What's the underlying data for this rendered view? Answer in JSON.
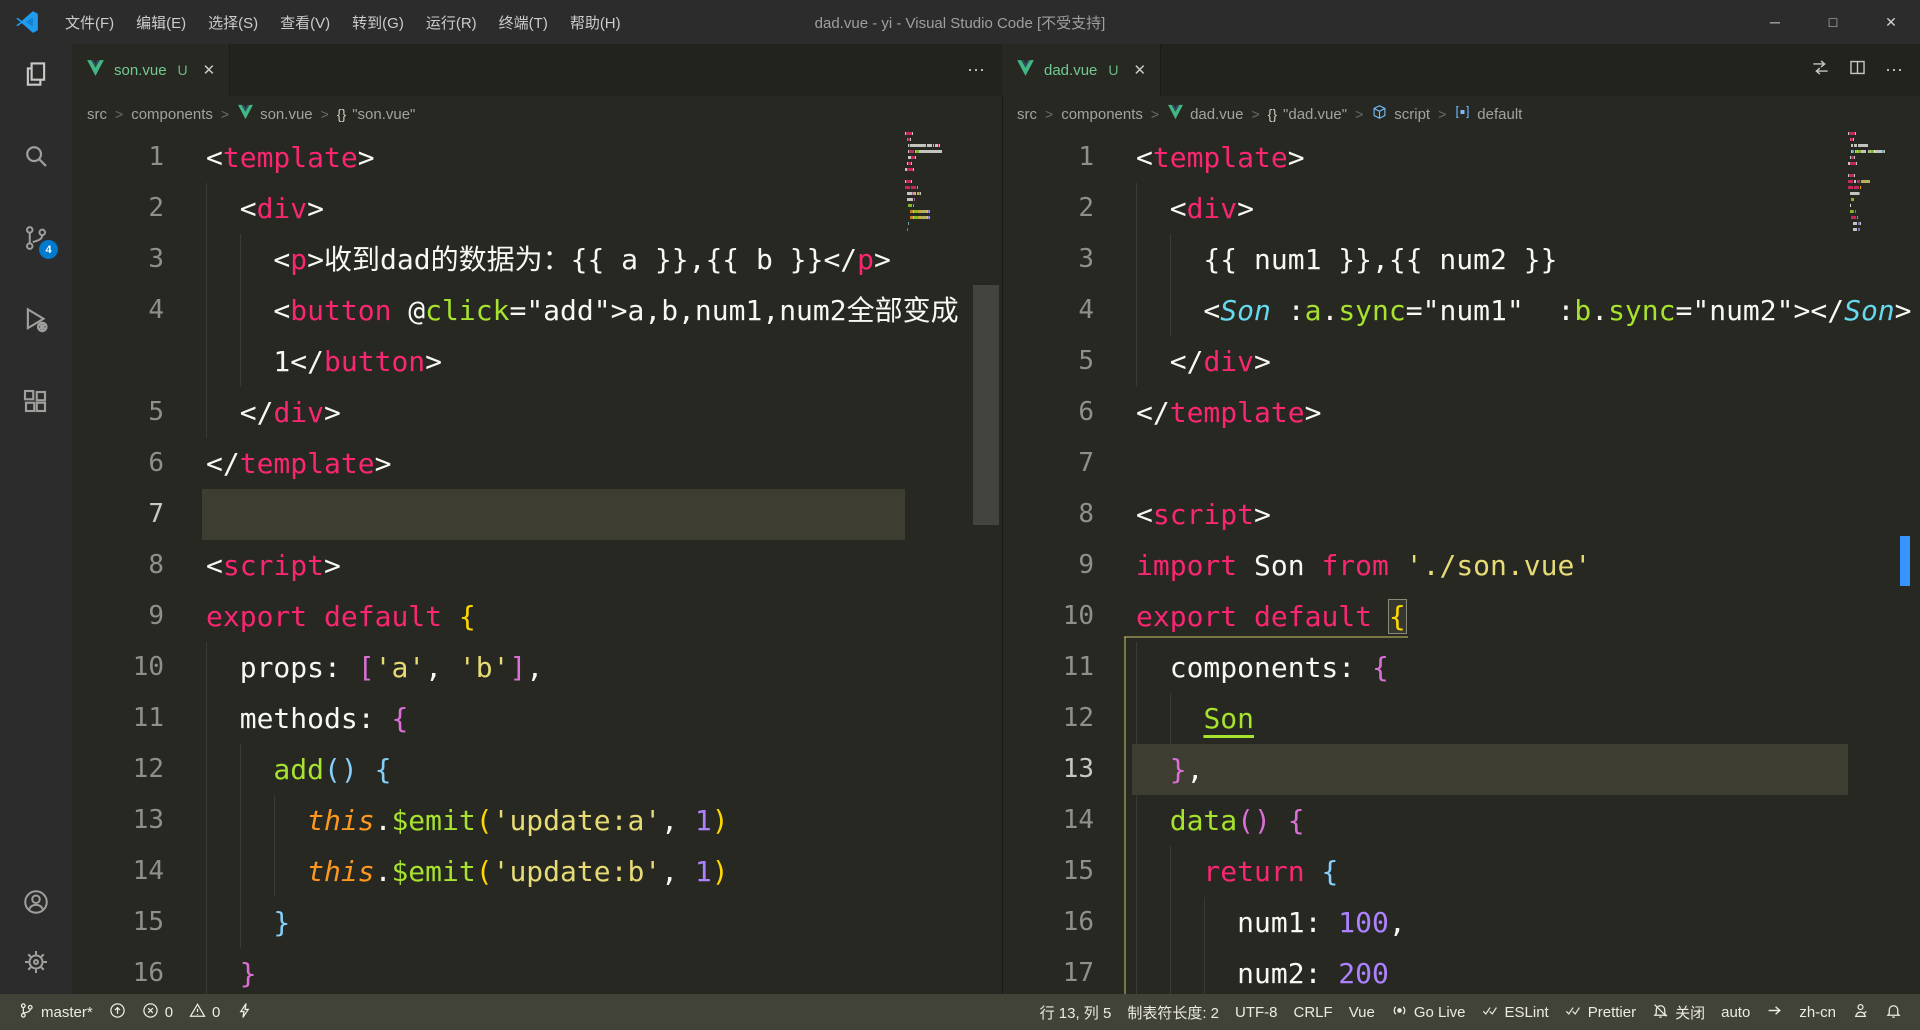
{
  "window": {
    "title": "dad.vue - yi - Visual Studio Code [不受支持]",
    "menus": [
      "文件(F)",
      "编辑(E)",
      "选择(S)",
      "查看(V)",
      "转到(G)",
      "运行(R)",
      "终端(T)",
      "帮助(H)"
    ],
    "glyphs": {
      "minimize": "─",
      "maximize": "□",
      "close": "✕",
      "ellipsis": "⋯",
      "braces": "{}",
      "crumb_sep": ">"
    }
  },
  "activity_bar": {
    "items": [
      {
        "name": "explorer",
        "icon": "files",
        "badge": ""
      },
      {
        "name": "search",
        "icon": "search",
        "badge": ""
      },
      {
        "name": "source-control",
        "icon": "scm",
        "badge": "4"
      },
      {
        "name": "run-and-debug",
        "icon": "debug",
        "badge": ""
      },
      {
        "name": "extensions",
        "icon": "extensions",
        "badge": ""
      }
    ],
    "bottom": [
      {
        "name": "accounts",
        "icon": "account"
      },
      {
        "name": "settings",
        "icon": "gear"
      }
    ]
  },
  "colors": {
    "accent": "#007acc",
    "editor_bg": "#272822",
    "line_highlight": "#3e3d32",
    "tab_modified_green": "#73c991",
    "overview_mark_blue": "#3794ff",
    "tokens": {
      "fg": "#f8f8f2",
      "tag": "#f92672",
      "kw": "#f92672",
      "attr": "#a6e22e",
      "attru": "#a6e22e",
      "str": "#e6db74",
      "num": "#ae81ff",
      "this": "#fd971f",
      "cls": "#66d9ef",
      "b1": "#ffd700",
      "b1m": "#ffd700",
      "b2": "#da70d6",
      "b3": "#87cefa"
    }
  },
  "groups": [
    {
      "name": "left",
      "tab": {
        "file": "son.vue",
        "git": "U"
      },
      "actions": [
        "ellipsis"
      ],
      "breadcrumb": [
        {
          "label": "src"
        },
        {
          "label": "components"
        },
        {
          "label": "son.vue",
          "icon": "vue"
        },
        {
          "label": "\"son.vue\"",
          "icon": "braces"
        }
      ],
      "lines": [
        {
          "n": "1",
          "i": 0,
          "t": [
            [
              "<",
              "fg"
            ],
            [
              "template",
              "tag"
            ],
            [
              ">",
              "fg"
            ]
          ]
        },
        {
          "n": "2",
          "i": 2,
          "t": [
            [
              "  <",
              "fg"
            ],
            [
              "div",
              "tag"
            ],
            [
              ">",
              "fg"
            ]
          ]
        },
        {
          "n": "3",
          "i": 4,
          "t": [
            [
              "    <",
              "fg"
            ],
            [
              "p",
              "tag"
            ],
            [
              ">",
              "fg"
            ],
            [
              "收到dad的数据为：{{ a }},{{ b }}",
              "fg"
            ],
            [
              "</",
              "fg"
            ],
            [
              "p",
              "tag"
            ],
            [
              ">",
              "fg"
            ]
          ]
        },
        {
          "n": "4",
          "i": 4,
          "t": [
            [
              "    <",
              "fg"
            ],
            [
              "button",
              "tag"
            ],
            [
              " @",
              "fg"
            ],
            [
              "click",
              "attr"
            ],
            [
              "=",
              "fg"
            ],
            [
              "\"add\"",
              "fg"
            ],
            [
              ">",
              "fg"
            ],
            [
              "a,b,num1,num2全部变成",
              "fg"
            ]
          ]
        },
        {
          "n": "",
          "i": 4,
          "w": 1,
          "t": [
            [
              "    1",
              "fg"
            ],
            [
              "</",
              "fg"
            ],
            [
              "button",
              "tag"
            ],
            [
              ">",
              "fg"
            ]
          ]
        },
        {
          "n": "5",
          "i": 2,
          "t": [
            [
              "  </",
              "fg"
            ],
            [
              "div",
              "tag"
            ],
            [
              ">",
              "fg"
            ]
          ]
        },
        {
          "n": "6",
          "i": 0,
          "t": [
            [
              "</",
              "fg"
            ],
            [
              "template",
              "tag"
            ],
            [
              ">",
              "fg"
            ]
          ]
        },
        {
          "n": "7",
          "i": 0,
          "c": 1,
          "t": []
        },
        {
          "n": "8",
          "i": 0,
          "t": [
            [
              "<",
              "fg"
            ],
            [
              "script",
              "tag"
            ],
            [
              ">",
              "fg"
            ]
          ]
        },
        {
          "n": "9",
          "i": 0,
          "t": [
            [
              "export",
              "kw"
            ],
            [
              " ",
              "fg"
            ],
            [
              "default",
              "kw"
            ],
            [
              " ",
              "fg"
            ],
            [
              "{",
              "b1"
            ]
          ]
        },
        {
          "n": "10",
          "i": 2,
          "t": [
            [
              "  props",
              "fg"
            ],
            [
              ": ",
              "fg"
            ],
            [
              "[",
              "b2"
            ],
            [
              "'a'",
              "str"
            ],
            [
              ", ",
              "fg"
            ],
            [
              "'b'",
              "str"
            ],
            [
              "]",
              "b2"
            ],
            [
              ",",
              "fg"
            ]
          ]
        },
        {
          "n": "11",
          "i": 2,
          "t": [
            [
              "  methods",
              "fg"
            ],
            [
              ": ",
              "fg"
            ],
            [
              "{",
              "b2"
            ]
          ]
        },
        {
          "n": "12",
          "i": 4,
          "t": [
            [
              "    add",
              "attr"
            ],
            [
              "()",
              "b3"
            ],
            [
              " ",
              "fg"
            ],
            [
              "{",
              "b3"
            ]
          ]
        },
        {
          "n": "13",
          "i": 6,
          "t": [
            [
              "      this",
              "this"
            ],
            [
              ".",
              "fg"
            ],
            [
              "$emit",
              "attr"
            ],
            [
              "(",
              "b1"
            ],
            [
              "'update:a'",
              "str"
            ],
            [
              ", ",
              "fg"
            ],
            [
              "1",
              "num"
            ],
            [
              ")",
              "b1"
            ]
          ]
        },
        {
          "n": "14",
          "i": 6,
          "t": [
            [
              "      this",
              "this"
            ],
            [
              ".",
              "fg"
            ],
            [
              "$emit",
              "attr"
            ],
            [
              "(",
              "b1"
            ],
            [
              "'update:b'",
              "str"
            ],
            [
              ", ",
              "fg"
            ],
            [
              "1",
              "num"
            ],
            [
              ")",
              "b1"
            ]
          ]
        },
        {
          "n": "15",
          "i": 4,
          "t": [
            [
              "    }",
              "b3"
            ]
          ]
        },
        {
          "n": "16",
          "i": 2,
          "t": [
            [
              "  }",
              "b2"
            ]
          ]
        }
      ]
    },
    {
      "name": "right",
      "tab": {
        "file": "dad.vue",
        "git": "U"
      },
      "actions": [
        "compare",
        "split",
        "ellipsis"
      ],
      "breadcrumb": [
        {
          "label": "src"
        },
        {
          "label": "components"
        },
        {
          "label": "dad.vue",
          "icon": "vue"
        },
        {
          "label": "\"dad.vue\"",
          "icon": "braces"
        },
        {
          "label": "script",
          "icon": "cube"
        },
        {
          "label": "default",
          "icon": "symbol"
        }
      ],
      "lines": [
        {
          "n": "1",
          "i": 0,
          "t": [
            [
              "<",
              "fg"
            ],
            [
              "template",
              "tag"
            ],
            [
              ">",
              "fg"
            ]
          ]
        },
        {
          "n": "2",
          "i": 2,
          "t": [
            [
              "  <",
              "fg"
            ],
            [
              "div",
              "tag"
            ],
            [
              ">",
              "fg"
            ]
          ]
        },
        {
          "n": "3",
          "i": 4,
          "t": [
            [
              "    {{ num1 }},{{ num2 }}",
              "fg"
            ]
          ]
        },
        {
          "n": "4",
          "i": 4,
          "t": [
            [
              "    <",
              "fg"
            ],
            [
              "Son",
              "cls"
            ],
            [
              " :",
              "fg"
            ],
            [
              "a",
              "attr"
            ],
            [
              ".",
              "fg"
            ],
            [
              "sync",
              "attr"
            ],
            [
              "=",
              "fg"
            ],
            [
              "\"num1\"",
              "fg"
            ],
            [
              "  :",
              "fg"
            ],
            [
              "b",
              "attr"
            ],
            [
              ".",
              "fg"
            ],
            [
              "sync",
              "attr"
            ],
            [
              "=",
              "fg"
            ],
            [
              "\"num2\"",
              "fg"
            ],
            [
              "></",
              "fg"
            ],
            [
              "Son",
              "cls"
            ],
            [
              ">",
              "fg"
            ]
          ]
        },
        {
          "n": "5",
          "i": 2,
          "t": [
            [
              "  </",
              "fg"
            ],
            [
              "div",
              "tag"
            ],
            [
              ">",
              "fg"
            ]
          ]
        },
        {
          "n": "6",
          "i": 0,
          "t": [
            [
              "</",
              "fg"
            ],
            [
              "template",
              "tag"
            ],
            [
              ">",
              "fg"
            ]
          ]
        },
        {
          "n": "7",
          "i": 0,
          "t": []
        },
        {
          "n": "8",
          "i": 0,
          "t": [
            [
              "<",
              "fg"
            ],
            [
              "script",
              "tag"
            ],
            [
              ">",
              "fg"
            ]
          ]
        },
        {
          "n": "9",
          "i": 0,
          "t": [
            [
              "import",
              "kw"
            ],
            [
              " Son ",
              "fg"
            ],
            [
              "from",
              "kw"
            ],
            [
              " ",
              "fg"
            ],
            [
              "'./son.vue'",
              "str"
            ]
          ]
        },
        {
          "n": "10",
          "i": 0,
          "t": [
            [
              "export",
              "kw"
            ],
            [
              " ",
              "fg"
            ],
            [
              "default",
              "kw"
            ],
            [
              " ",
              "fg"
            ],
            [
              "{",
              "b1m"
            ]
          ]
        },
        {
          "n": "11",
          "i": 2,
          "t": [
            [
              "  components",
              "fg"
            ],
            [
              ": ",
              "fg"
            ],
            [
              "{",
              "b2"
            ]
          ]
        },
        {
          "n": "12",
          "i": 4,
          "t": [
            [
              "    ",
              "fg"
            ],
            [
              "Son",
              "attru"
            ]
          ]
        },
        {
          "n": "13",
          "i": 2,
          "c": 1,
          "t": [
            [
              "  }",
              "b2"
            ],
            [
              ",",
              "fg"
            ]
          ]
        },
        {
          "n": "14",
          "i": 2,
          "t": [
            [
              "  data",
              "attr"
            ],
            [
              "()",
              "b2"
            ],
            [
              " ",
              "fg"
            ],
            [
              "{",
              "b2"
            ]
          ]
        },
        {
          "n": "15",
          "i": 4,
          "t": [
            [
              "    return",
              "kw"
            ],
            [
              " ",
              "fg"
            ],
            [
              "{",
              "b3"
            ]
          ]
        },
        {
          "n": "16",
          "i": 6,
          "t": [
            [
              "      num1",
              "fg"
            ],
            [
              ": ",
              "fg"
            ],
            [
              "100",
              "num"
            ],
            [
              ",",
              "fg"
            ]
          ]
        },
        {
          "n": "17",
          "i": 6,
          "t": [
            [
              "      num2",
              "fg"
            ],
            [
              ": ",
              "fg"
            ],
            [
              "200",
              "num"
            ]
          ]
        }
      ]
    }
  ],
  "status_bar": {
    "left": [
      {
        "name": "git-branch",
        "icon": "branch",
        "label": "master*"
      },
      {
        "name": "publish-changes",
        "icon": "publish",
        "label": ""
      },
      {
        "name": "errors",
        "icon": "error",
        "label": "0"
      },
      {
        "name": "warnings",
        "icon": "warning",
        "label": "0"
      },
      {
        "name": "live-reload",
        "icon": "bolt",
        "label": ""
      }
    ],
    "right": [
      {
        "name": "cursor-position",
        "label": "行 13, 列 5"
      },
      {
        "name": "indentation",
        "label": "制表符长度: 2"
      },
      {
        "name": "encoding",
        "label": "UTF-8"
      },
      {
        "name": "eol",
        "label": "CRLF"
      },
      {
        "name": "language-mode",
        "label": "Vue"
      },
      {
        "name": "go-live",
        "icon": "broadcast",
        "label": "Go Live"
      },
      {
        "name": "eslint",
        "icon": "check2",
        "label": "ESLint"
      },
      {
        "name": "prettier",
        "icon": "check2",
        "label": "Prettier"
      },
      {
        "name": "notifications-toggle",
        "icon": "bellslash",
        "label": "关闭"
      },
      {
        "name": "auto-detect",
        "label": "auto"
      },
      {
        "name": "arrow",
        "icon": "arrowRight",
        "label": ""
      },
      {
        "name": "display-language",
        "label": "zh-cn"
      },
      {
        "name": "feedback",
        "icon": "person",
        "label": ""
      },
      {
        "name": "notifications-bell",
        "icon": "bell",
        "label": ""
      }
    ]
  }
}
